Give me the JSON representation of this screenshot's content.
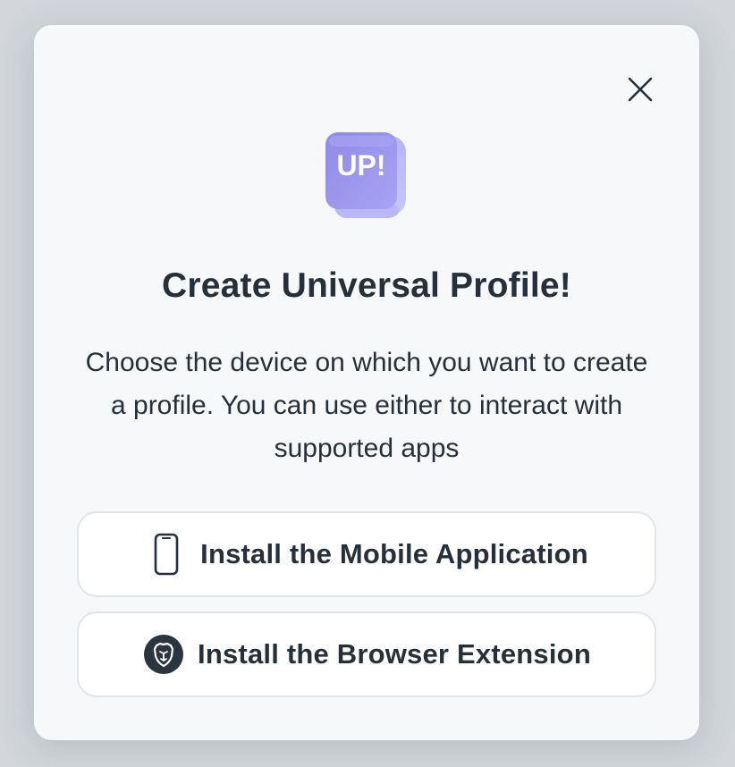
{
  "modal": {
    "title": "Create Universal Profile!",
    "description": "Choose the device on which you want to create a profile. You can use either to interact with supported apps",
    "logo_text": "UP!",
    "close_icon": "close-icon"
  },
  "options": [
    {
      "label": "Install the Mobile Application",
      "icon": "mobile-phone-icon"
    },
    {
      "label": "Install the Browser Extension",
      "icon": "brave-browser-icon"
    }
  ],
  "colors": {
    "text": "#25303b",
    "modal_bg": "#f7f8fa",
    "button_bg": "#ffffff",
    "button_border": "#e1e4e8",
    "logo_purple": "#9b96ee"
  }
}
